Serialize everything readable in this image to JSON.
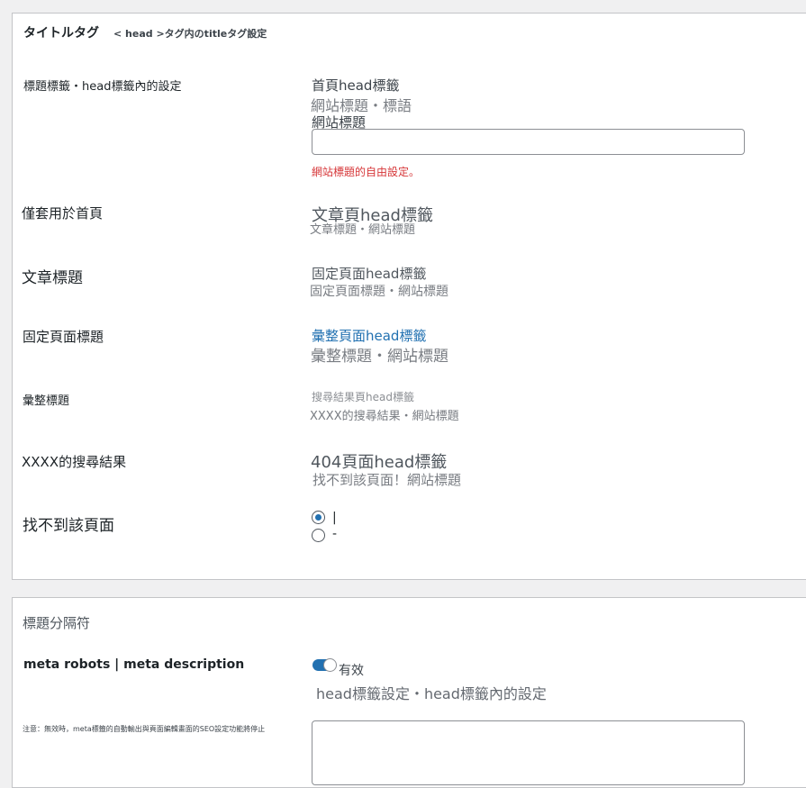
{
  "section1": {
    "title": "タイトルタグ",
    "subtitle": "< head >タグ内のtitleタグ設定",
    "rows": [
      {
        "label": "標題標籤・head標籤內的設定"
      },
      {
        "label": "僅套用於首頁"
      },
      {
        "label": "文章標題"
      },
      {
        "label": "固定頁面標題"
      },
      {
        "label": "彙整標題"
      },
      {
        "label": "XXXX的搜尋結果"
      },
      {
        "label": "找不到該頁面"
      }
    ],
    "right": {
      "home_heading": "首頁head標籤",
      "home_value": "網站標題・標語",
      "site_title_label": "網站標題",
      "site_title_value": "",
      "site_title_help": "網站標題的自由設定。",
      "post_heading": "文章頁head標籤",
      "post_value": "文章標題・網站標題",
      "page_heading": "固定頁面head標籤",
      "page_value": "固定頁面標題・網站標題",
      "archive_heading": "彙整頁面head標籤",
      "archive_value": "彙整標題・網站標題",
      "search_heading": "搜尋結果頁head標籤",
      "search_value": "XXXX的搜尋結果・網站標題",
      "notfound_heading": "404頁面head標籤",
      "notfound_value": "找不到該頁面！網站標題",
      "separator_options": [
        "|",
        "-"
      ]
    }
  },
  "section2": {
    "title": "標題分隔符",
    "meta_label": "meta robots | meta description",
    "toggle_label": "有效",
    "toggle_state": true,
    "meta_heading": "head標籤設定・head標籤內的設定",
    "note": "注意：無效時，meta標籤的自動輸出與頁面編輯畫面的SEO設定功能將停止",
    "textarea_value": ""
  },
  "colors": {
    "accent": "#2271b1",
    "error": "#d63638",
    "border": "#c3c4c7",
    "background": "#f0f0f1"
  }
}
